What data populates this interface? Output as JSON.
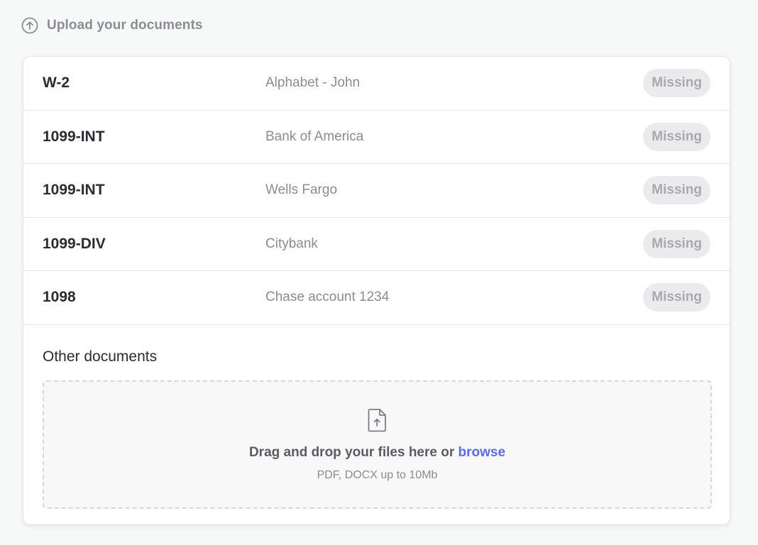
{
  "header": {
    "title": "Upload your documents",
    "icon": "upload-circle-icon"
  },
  "documents": [
    {
      "type": "W-2",
      "issuer": "Alphabet - John",
      "status": "Missing"
    },
    {
      "type": "1099-INT",
      "issuer": "Bank of America",
      "status": "Missing"
    },
    {
      "type": "1099-INT",
      "issuer": "Wells Fargo",
      "status": "Missing"
    },
    {
      "type": "1099-DIV",
      "issuer": "Citybank",
      "status": "Missing"
    },
    {
      "type": "1098",
      "issuer": "Chase account 1234",
      "status": "Missing"
    }
  ],
  "other": {
    "title": "Other documents",
    "drop_text": "Drag and drop your files here or ",
    "browse_label": "browse",
    "hint": "PDF, DOCX up to 10Mb",
    "icon": "file-upload-icon"
  },
  "colors": {
    "accent": "#5b6cdf",
    "badge_bg": "#ebebee",
    "badge_text": "#a8a9b0"
  }
}
